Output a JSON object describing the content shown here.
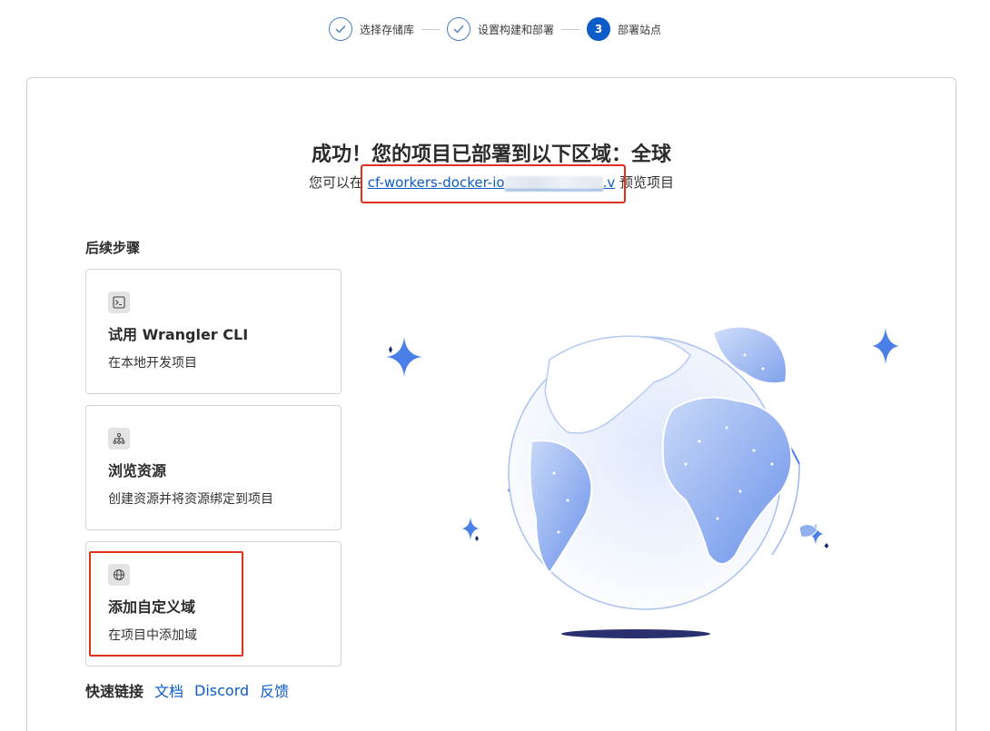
{
  "stepper": {
    "steps": [
      {
        "label": "选择存储库",
        "state": "done"
      },
      {
        "label": "设置构建和部署",
        "state": "done"
      },
      {
        "label": "部署站点",
        "state": "active",
        "number": "3"
      }
    ]
  },
  "main": {
    "title": "成功！您的项目已部署到以下区域：全球",
    "subtitle_prefix": "您可以在",
    "link_start": "cf-workers-docker-io",
    "link_end": ".v",
    "subtitle_suffix": "预览项目"
  },
  "next_steps": {
    "heading": "后续步骤",
    "items": [
      {
        "title": "试用 Wrangler CLI",
        "desc": "在本地开发项目",
        "icon": "terminal-icon"
      },
      {
        "title": "浏览资源",
        "desc": "创建资源并将资源绑定到项目",
        "icon": "hierarchy-icon"
      },
      {
        "title": "添加自定义域",
        "desc": "在项目中添加域",
        "icon": "globe-icon"
      }
    ]
  },
  "quick_links": {
    "label": "快速链接",
    "links": [
      "文档",
      "Discord",
      "反馈"
    ]
  },
  "colors": {
    "accent": "#0d5cc7",
    "highlight_box": "#e0301e",
    "globe_blue": "#6b92ea"
  }
}
